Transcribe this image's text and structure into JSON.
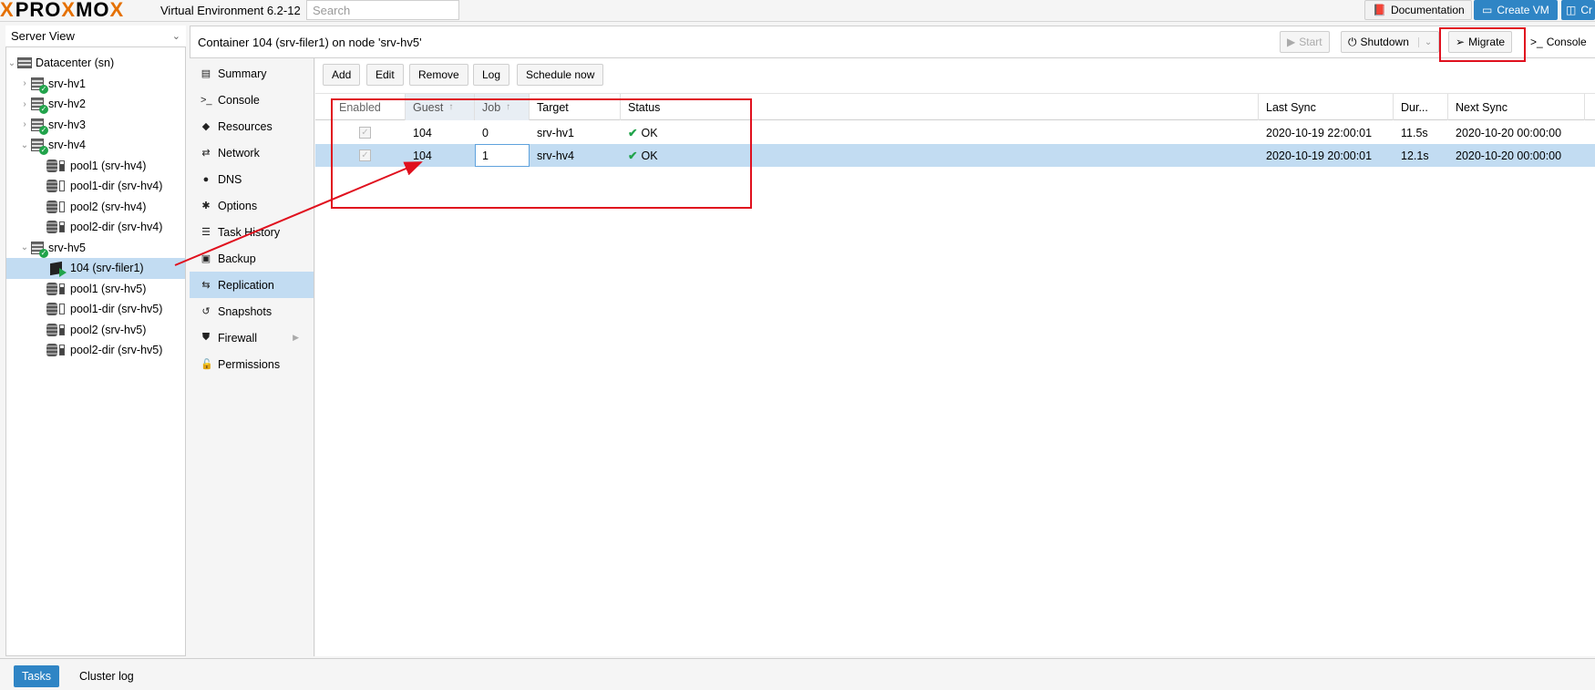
{
  "topbar": {
    "logo_x": "X",
    "logo_pro": "PRO",
    "logo_x2": "X",
    "logo_mo": "MO",
    "logo_x3": "X",
    "version": "Virtual Environment 6.2-12",
    "search_placeholder": "Search",
    "documentation_label": "Documentation",
    "create_vm_label": "Create VM",
    "create_ct_label": "Cr"
  },
  "tree": {
    "view_label": "Server View",
    "items": [
      {
        "label": "Datacenter (sn)"
      },
      {
        "label": "srv-hv1"
      },
      {
        "label": "srv-hv2"
      },
      {
        "label": "srv-hv3"
      },
      {
        "label": "srv-hv4"
      },
      {
        "label": "pool1 (srv-hv4)"
      },
      {
        "label": "pool1-dir (srv-hv4)"
      },
      {
        "label": "pool2 (srv-hv4)"
      },
      {
        "label": "pool2-dir (srv-hv4)"
      },
      {
        "label": "srv-hv5"
      },
      {
        "label": "104 (srv-filer1)"
      },
      {
        "label": "pool1 (srv-hv5)"
      },
      {
        "label": "pool1-dir (srv-hv5)"
      },
      {
        "label": "pool2 (srv-hv5)"
      },
      {
        "label": "pool2-dir (srv-hv5)"
      }
    ]
  },
  "header": {
    "title": "Container 104 (srv-filer1) on node 'srv-hv5'",
    "start_label": "Start",
    "shutdown_label": "Shutdown",
    "migrate_label": "Migrate",
    "console_label": "Console"
  },
  "nav": {
    "items": [
      {
        "label": "Summary",
        "icon": "▤"
      },
      {
        "label": "Console",
        "icon": ">_"
      },
      {
        "label": "Resources",
        "icon": "◆"
      },
      {
        "label": "Network",
        "icon": "⇄"
      },
      {
        "label": "DNS",
        "icon": "●"
      },
      {
        "label": "Options",
        "icon": "✱"
      },
      {
        "label": "Task History",
        "icon": "☰"
      },
      {
        "label": "Backup",
        "icon": "▣"
      },
      {
        "label": "Replication",
        "icon": "⇆"
      },
      {
        "label": "Snapshots",
        "icon": "↺"
      },
      {
        "label": "Firewall",
        "icon": "⛊"
      },
      {
        "label": "Permissions",
        "icon": "🔓"
      }
    ]
  },
  "toolbar": {
    "add_label": "Add",
    "edit_label": "Edit",
    "remove_label": "Remove",
    "log_label": "Log",
    "schedule_label": "Schedule now"
  },
  "grid": {
    "columns": {
      "enabled": "Enabled",
      "guest": "Guest",
      "job": "Job",
      "target": "Target",
      "status": "Status",
      "last_sync": "Last Sync",
      "duration": "Dur...",
      "next_sync": "Next Sync"
    },
    "rows": [
      {
        "guest": "104",
        "job": "0",
        "target": "srv-hv1",
        "status": "OK",
        "last_sync": "2020-10-19 22:00:01",
        "duration": "11.5s",
        "next_sync": "2020-10-20 00:00:00"
      },
      {
        "guest": "104",
        "job": "1",
        "target": "srv-hv4",
        "status": "OK",
        "last_sync": "2020-10-19 20:00:01",
        "duration": "12.1s",
        "next_sync": "2020-10-20 00:00:00"
      }
    ]
  },
  "bottom": {
    "tasks_label": "Tasks",
    "cluster_log_label": "Cluster log"
  }
}
